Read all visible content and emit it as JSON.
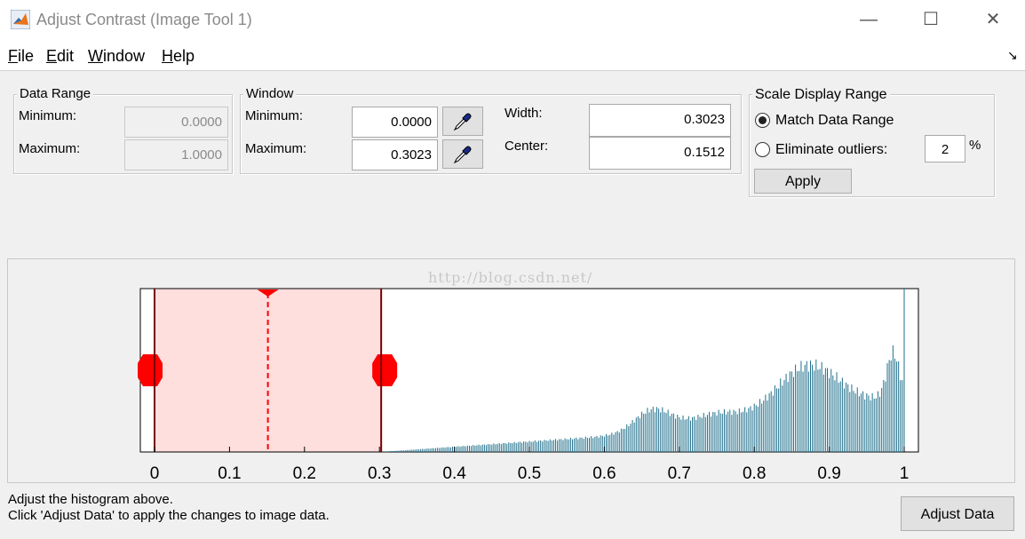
{
  "window": {
    "title": "Adjust Contrast (Image Tool 1)",
    "minimize_glyph": "—",
    "maximize_glyph": "☐",
    "close_glyph": "✕"
  },
  "menu": [
    "File",
    "Edit",
    "Window",
    "Help"
  ],
  "dock_glyph": "↘",
  "data_range": {
    "title": "Data Range",
    "min_label": "Minimum:",
    "min_value": "0.0000",
    "max_label": "Maximum:",
    "max_value": "1.0000"
  },
  "window_group": {
    "title": "Window",
    "min_label": "Minimum:",
    "min_value": "0.0000",
    "max_label": "Maximum:",
    "max_value": "0.3023",
    "width_label": "Width:",
    "width_value": "0.3023",
    "center_label": "Center:",
    "center_value": "0.1512"
  },
  "scale_display": {
    "title": "Scale Display Range",
    "option_match": "Match Data Range",
    "option_eliminate": "Eliminate outliers:",
    "selected": "match",
    "outlier_percent": "2",
    "percent_sign": "%",
    "apply_label": "Apply"
  },
  "watermark": "http://blog.csdn.net/",
  "histogram": {
    "window_min": 0.0,
    "window_max": 0.3023,
    "window_center": 0.1512,
    "bar_color": "#1f6f8b",
    "window_fill": "#ffdede",
    "window_edge_color": "#ff0000",
    "ticks": [
      "0",
      "0.1",
      "0.2",
      "0.3",
      "0.4",
      "0.5",
      "0.6",
      "0.7",
      "0.8",
      "0.9",
      "1"
    ]
  },
  "status": {
    "line1": "Adjust the histogram above.",
    "line2": "Click 'Adjust Data' to apply the changes to image data."
  },
  "adjust_button": "Adjust Data"
}
